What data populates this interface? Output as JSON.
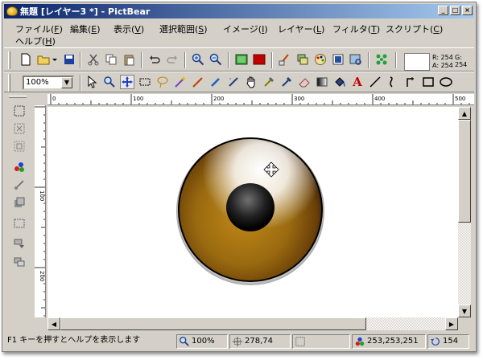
{
  "window": {
    "title": "無題 [レイヤー3 *] - PictBear"
  },
  "menu": [
    {
      "label": "ファイル(",
      "key": "F",
      "end": ")"
    },
    {
      "label": "編集(",
      "key": "E",
      "end": ")"
    },
    {
      "label": "表示(",
      "key": "V",
      "end": ")"
    },
    {
      "label": "選択範囲(",
      "key": "S",
      "end": ")"
    },
    {
      "label": "イメージ(",
      "key": "I",
      "end": ")"
    },
    {
      "label": "レイヤー(",
      "key": "L",
      "end": ")"
    },
    {
      "label": "フィルタ(",
      "key": "T",
      "end": ")"
    },
    {
      "label": "スクリプト(",
      "key": "C",
      "end": ")"
    },
    {
      "label": "ヘルプ(",
      "key": "H",
      "end": ")"
    }
  ],
  "toolbar2": {
    "zoom_value": "100%"
  },
  "color_readout": {
    "r": "R: 254",
    "g": "G: 254",
    "a": "A: 254"
  },
  "ruler": {
    "top_labels": [
      "0",
      "100",
      "200",
      "300",
      "400",
      "500"
    ],
    "left_labels": [
      "100",
      "200"
    ]
  },
  "status": {
    "help": "F1 キーを押すとヘルプを表示します",
    "zoom": "100%",
    "cursor": "278,74",
    "color": "253,253,251",
    "layer_count": "154"
  },
  "colors": {
    "title_start": "#0a246a",
    "title_end": "#a6caf0",
    "face": "#d4d0c8",
    "eye_brown": "#8a5a10"
  }
}
